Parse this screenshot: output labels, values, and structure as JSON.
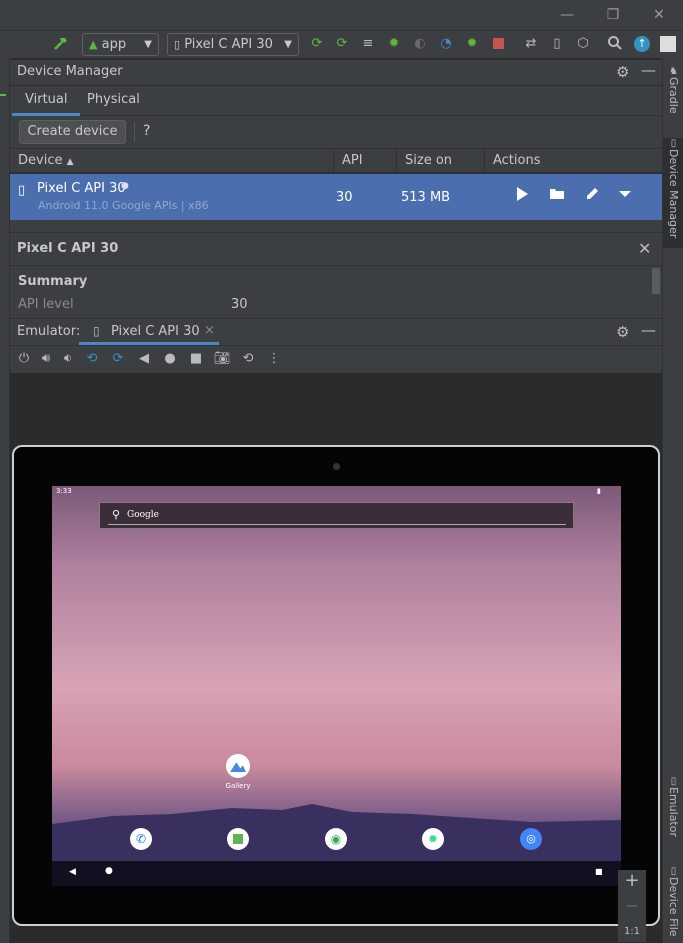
{
  "window": {
    "minimize": "—",
    "restore": "❐",
    "close": "✕"
  },
  "toolbar": {
    "config_label": "app",
    "device_label": "Pixel C API 30"
  },
  "device_manager": {
    "title": "Device Manager",
    "tabs": [
      "Virtual",
      "Physical"
    ],
    "create_button": "Create device",
    "help": "?",
    "columns": [
      "Device",
      "API",
      "Size on Disk",
      "Actions"
    ],
    "rows": [
      {
        "name": "Pixel C API 30",
        "subtitle": "Android 11.0 Google APIs | x86",
        "api": "30",
        "size": "513 MB"
      }
    ]
  },
  "details": {
    "title": "Pixel C API 30",
    "section": "Summary",
    "fields": [
      {
        "label": "API level",
        "value": "30"
      }
    ]
  },
  "emulator": {
    "label": "Emulator:",
    "tab": "Pixel C API 30",
    "tab_close": "×",
    "zoom_in": "+",
    "zoom_out": "−",
    "zoom_ratio": "1:1"
  },
  "android": {
    "time": "3:33",
    "search_text": "Google",
    "desktop_app": "Gallery"
  },
  "right_sidebar": [
    "Gradle",
    "Device Manager",
    "Emulator",
    "Device File"
  ],
  "colors": {
    "selection": "#4b6eaf",
    "panel": "#3c3f41",
    "accent": "#4a88c7"
  }
}
